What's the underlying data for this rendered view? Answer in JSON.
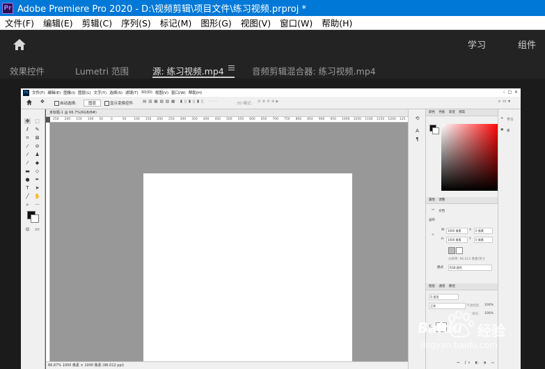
{
  "window": {
    "logo_text": "Pr",
    "title": "Adobe Premiere Pro 2020 - D:\\视频剪辑\\项目文件\\练习视频.prproj *"
  },
  "menu": [
    "文件(F)",
    "编辑(E)",
    "剪辑(C)",
    "序列(S)",
    "标记(M)",
    "图形(G)",
    "视图(V)",
    "窗口(W)",
    "帮助(H)"
  ],
  "header": {
    "workspace_learn": "学习",
    "workspace_assembly": "组件"
  },
  "tabs": [
    {
      "label": "效果控件",
      "active": false
    },
    {
      "label": "Lumetri 范围",
      "active": false
    },
    {
      "label": "源: 练习视频.mp4",
      "active": true
    },
    {
      "label": "音频剪辑混合器: 练习视频.mp4",
      "active": false
    }
  ],
  "photoshop": {
    "logo_text": "Ps",
    "menu": [
      "文件(F)",
      "编辑(E)",
      "图像(I)",
      "图层(L)",
      "文字(Y)",
      "选择(S)",
      "滤镜(T)",
      "3D(D)",
      "视图(V)",
      "窗口(W)",
      "帮助(H)"
    ],
    "options": {
      "auto_select": "自动选择:",
      "layer_dropdown": "图层",
      "show_transform": "显示变换控件",
      "mode_3d": "3D 模式:"
    },
    "doc_tab": "未标题-1 @ 66.7%(RGB/8#)",
    "ruler_marks": [
      "250",
      "200",
      "150",
      "100",
      "50",
      "0",
      "50",
      "100",
      "150",
      "200",
      "250",
      "300",
      "350",
      "400",
      "450",
      "500",
      "550",
      "600",
      "650",
      "700",
      "750",
      "800",
      "850",
      "900",
      "950",
      "1000",
      "1050",
      "1100",
      "1150",
      "1200",
      "125"
    ],
    "status": "66.67%   1000 像素 × 1000 像素 (96.012 ppi)",
    "color_tabs": [
      "颜色",
      "色板",
      "渐变",
      "图案"
    ],
    "props_tabs": [
      "属性",
      "调整"
    ],
    "props": {
      "doc_label": "文档",
      "canvas_label": "画布",
      "w_label": "W",
      "w_value": "1000 像素",
      "h_label": "H",
      "h_value": "1000 像素",
      "x_label": "X",
      "x_value": "0 像素",
      "y_label": "Y",
      "y_value": "0 像素",
      "resolution": "分辨率: 96.012 像素/英寸",
      "mode_label": "模式",
      "mode_value": "RGB 颜色"
    },
    "layers_tabs": [
      "图层",
      "通道",
      "路径"
    ],
    "layers": {
      "kind": "Q 类型",
      "blend": "正常",
      "opacity_label": "不透明度:",
      "opacity": "100%",
      "fill_label": "填充:",
      "fill": "100%"
    },
    "right_panel": {
      "learn": "学习",
      "library": "库"
    }
  },
  "watermark": {
    "brand": "Baidu",
    "brand_cn": "经验",
    "url": "jingyan.baidu.com"
  }
}
